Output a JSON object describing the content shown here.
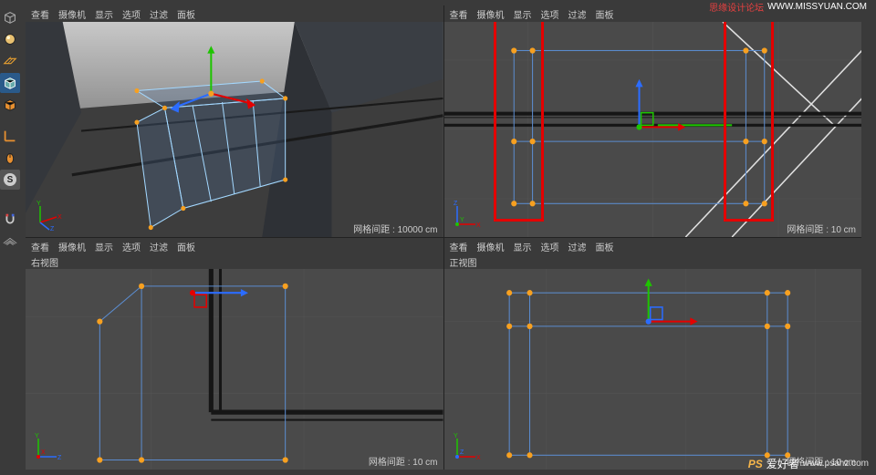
{
  "watermark": {
    "top_label": "思缘设计论坛",
    "top_url": "WWW.MISSYUAN.COM",
    "bottom_brand": "PS",
    "bottom_label": "爱好者",
    "bottom_url": "www.psahz.com"
  },
  "menubar": {
    "view": "查看",
    "camera": "摄像机",
    "display": "显示",
    "options": "选项",
    "filter": "过滤",
    "panel": "面板"
  },
  "viewports": {
    "tl": {
      "grid_label": "网格间距 : 10000 cm"
    },
    "tr": {
      "grid_label": "网格间距 : 10 cm"
    },
    "bl": {
      "title": "右视图",
      "grid_label": "网格间距 : 10 cm"
    },
    "br": {
      "title": "正视图",
      "grid_label": "网格间距 : 10 cm"
    }
  },
  "tools": {
    "cube": "cube",
    "sphere": "sphere",
    "plane": "plane",
    "cube2": "cube2",
    "cube3": "cube3",
    "axis": "axis",
    "mouse": "mouse",
    "s": "S",
    "magnet": "magnet",
    "grid": "grid"
  },
  "axes": {
    "x": "X",
    "y": "Y",
    "z": "Z"
  },
  "colors": {
    "red": "#e40000",
    "green": "#1ec400",
    "blue": "#2b6cff",
    "orange": "#f7a020",
    "wire": "#5b8ccf",
    "frame": "#a3d8ff",
    "dark": "#1a1a1a"
  }
}
